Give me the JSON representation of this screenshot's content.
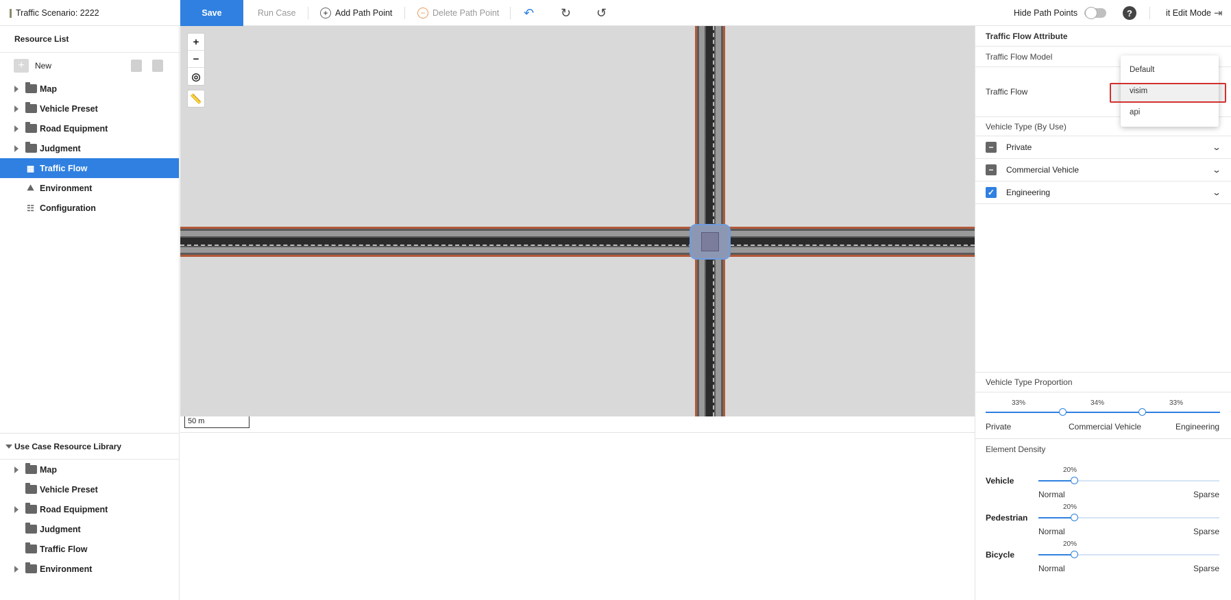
{
  "toolbar": {
    "title": "Traffic Scenario: 2222",
    "save": "Save",
    "run_case": "Run Case",
    "add_path_point": "Add Path Point",
    "delete_path_point": "Delete Path Point",
    "hide_path_points": "Hide Path Points",
    "hide_path_points_on": false,
    "exit_edit_mode": "it Edit Mode",
    "icons": [
      "plus-circle-icon",
      "minus-circle-icon",
      "undo-icon",
      "redo-icon",
      "reset-icon",
      "help-icon",
      "exit-icon"
    ]
  },
  "sidebar": {
    "resource_list_title": "Resource List",
    "new_label": "New",
    "items": [
      {
        "label": "Map",
        "type": "folder",
        "expandable": true
      },
      {
        "label": "Vehicle Preset",
        "type": "folder",
        "expandable": true
      },
      {
        "label": "Road Equipment",
        "type": "folder",
        "expandable": true
      },
      {
        "label": "Judgment",
        "type": "folder",
        "expandable": true
      },
      {
        "label": "Traffic Flow",
        "type": "leaf",
        "selected": true
      },
      {
        "label": "Environment",
        "type": "leaf"
      },
      {
        "label": "Configuration",
        "type": "leaf"
      }
    ],
    "library_title": "Use Case Resource Library",
    "library_items": [
      {
        "label": "Map",
        "expandable": true
      },
      {
        "label": "Vehicle Preset",
        "expandable": false
      },
      {
        "label": "Road Equipment",
        "expandable": true
      },
      {
        "label": "Judgment",
        "expandable": false
      },
      {
        "label": "Traffic Flow",
        "expandable": false
      },
      {
        "label": "Environment",
        "expandable": true
      }
    ]
  },
  "map": {
    "zoom_in": "+",
    "zoom_out": "−",
    "scale": "50 m"
  },
  "panel": {
    "attr_title": "Traffic Flow Attribute",
    "model_title": "Traffic Flow Model",
    "traffic_flow_label": "Traffic Flow",
    "dropdown_options": [
      "Default",
      "visim",
      "api"
    ],
    "dropdown_highlighted": "visim",
    "vehicle_type_title": "Vehicle Type (By Use)",
    "vehicle_types": [
      {
        "label": "Private",
        "state": "partial"
      },
      {
        "label": "Commercial Vehicle",
        "state": "partial"
      },
      {
        "label": "Engineering",
        "state": "checked"
      }
    ],
    "proportion_title": "Vehicle Type Proportion",
    "proportions": [
      {
        "label": "Private",
        "pct": "33%",
        "value": 33
      },
      {
        "label": "Commercial Vehicle",
        "pct": "34%",
        "value": 34
      },
      {
        "label": "Engineering",
        "pct": "33%",
        "value": 33
      }
    ],
    "density_title": "Element Density",
    "densities": [
      {
        "label": "Vehicle",
        "pct": "20%",
        "value": 20,
        "min_label": "Normal",
        "max_label": "Sparse"
      },
      {
        "label": "Pedestrian",
        "pct": "20%",
        "value": 20,
        "min_label": "Normal",
        "max_label": "Sparse"
      },
      {
        "label": "Bicycle",
        "pct": "20%",
        "value": 20,
        "min_label": "Normal",
        "max_label": "Sparse"
      }
    ]
  },
  "colors": {
    "accent": "#2f80e0",
    "highlight_border": "#d32f2f",
    "road_edge": "#b35a3a"
  }
}
